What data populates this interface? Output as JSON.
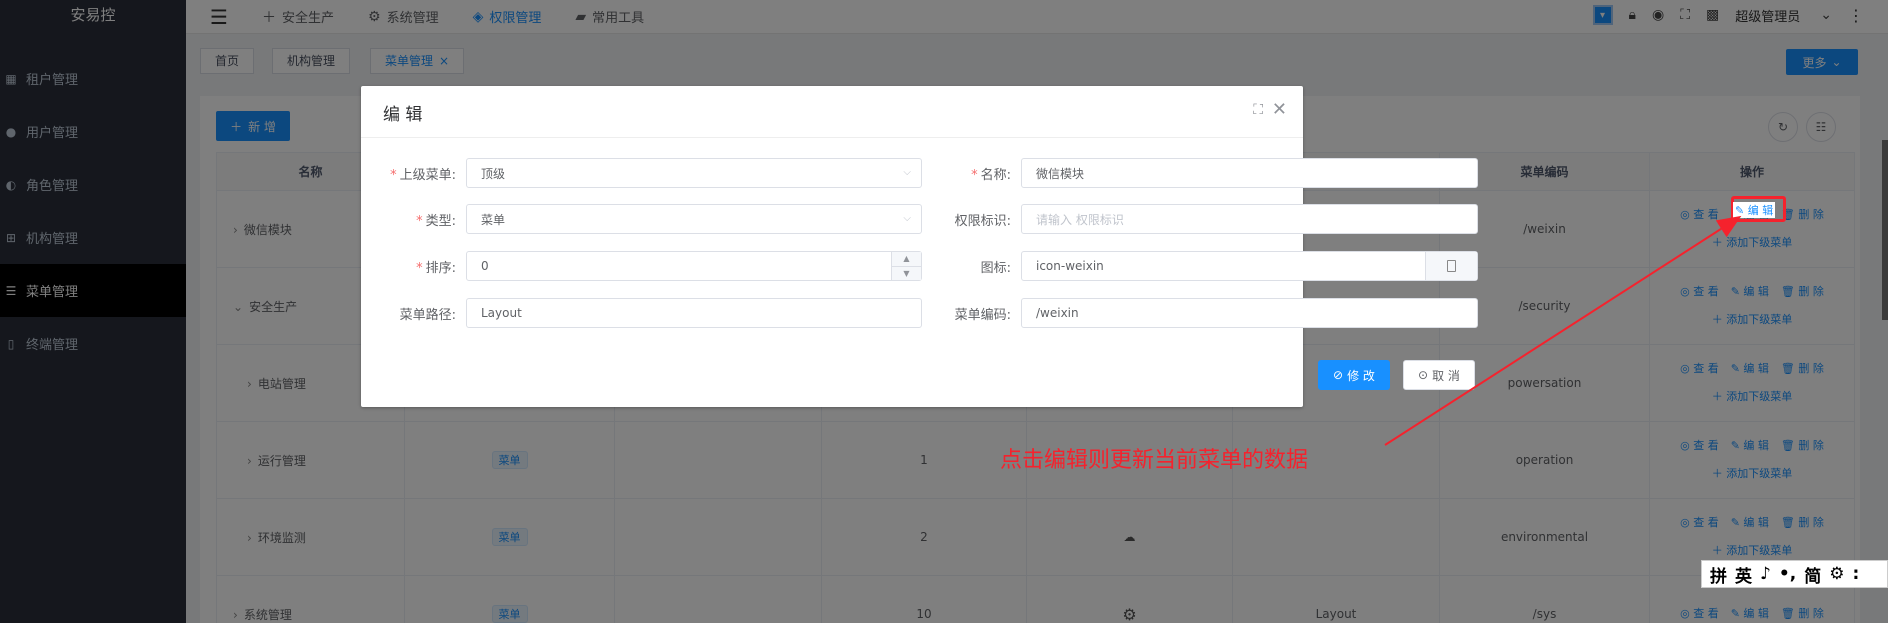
{
  "app": {
    "brand": "安易控"
  },
  "sidebar": {
    "items": [
      {
        "label": "租户管理",
        "icon": "grid-icon"
      },
      {
        "label": "用户管理",
        "icon": "user-icon"
      },
      {
        "label": "角色管理",
        "icon": "role-icon"
      },
      {
        "label": "机构管理",
        "icon": "org-icon"
      },
      {
        "label": "菜单管理",
        "icon": "menu-icon",
        "active": true
      },
      {
        "label": "终端管理",
        "icon": "device-icon"
      }
    ]
  },
  "topnav": {
    "items": [
      {
        "label": "安全生产",
        "icon": "plus-icon"
      },
      {
        "label": "系统管理",
        "icon": "gear-icon"
      },
      {
        "label": "权限管理",
        "icon": "shield-icon",
        "active": true
      },
      {
        "label": "常用工具",
        "icon": "briefcase-icon"
      }
    ],
    "user": "超级管理员"
  },
  "tags": {
    "items": [
      "首页",
      "机构管理",
      "菜单管理"
    ],
    "more": "更多"
  },
  "toolbar": {
    "add": "新 增"
  },
  "table": {
    "headers": {
      "name": "名称",
      "code": "菜单编码",
      "ops": "操作"
    },
    "rows": [
      {
        "name": "微信模块",
        "type": "",
        "sort": "",
        "path": "",
        "code": "/weixin"
      },
      {
        "name": "安全生产",
        "type": "",
        "sort": "",
        "path": "",
        "code": "/security"
      },
      {
        "name": "电站管理",
        "type": "",
        "sort": "",
        "path": "",
        "code": "powersation"
      },
      {
        "name": "运行管理",
        "type": "菜单",
        "sort": "1",
        "path": "",
        "code": "operation"
      },
      {
        "name": "环境监测",
        "type": "菜单",
        "sort": "2",
        "path": "",
        "code": "environmental"
      },
      {
        "name": "系统管理",
        "type": "菜单",
        "sort": "10",
        "path": "Layout",
        "code": "/sys"
      }
    ],
    "ops": {
      "view": "查 看",
      "edit": "编 辑",
      "delete": "删 除",
      "add_child": "添加下级菜单"
    }
  },
  "dialog": {
    "title": "编 辑",
    "fields": {
      "parent_label": "上级菜单:",
      "parent_value": "顶级",
      "name_label": "名称:",
      "name_value": "微信模块",
      "type_label": "类型:",
      "type_value": "菜单",
      "perm_label": "权限标识:",
      "perm_placeholder": "请输入 权限标识",
      "sort_label": "排序:",
      "sort_value": "0",
      "icon_label": "图标:",
      "icon_value": "icon-weixin",
      "path_label": "菜单路径:",
      "path_value": "Layout",
      "code_label": "菜单编码:",
      "code_value": "/weixin"
    },
    "submit": "修 改",
    "cancel": "取 消"
  },
  "annotation": "点击编辑则更新当前菜单的数据",
  "ime": [
    "拼",
    "英",
    "♪",
    "•,",
    "简",
    "⚙",
    ":"
  ]
}
